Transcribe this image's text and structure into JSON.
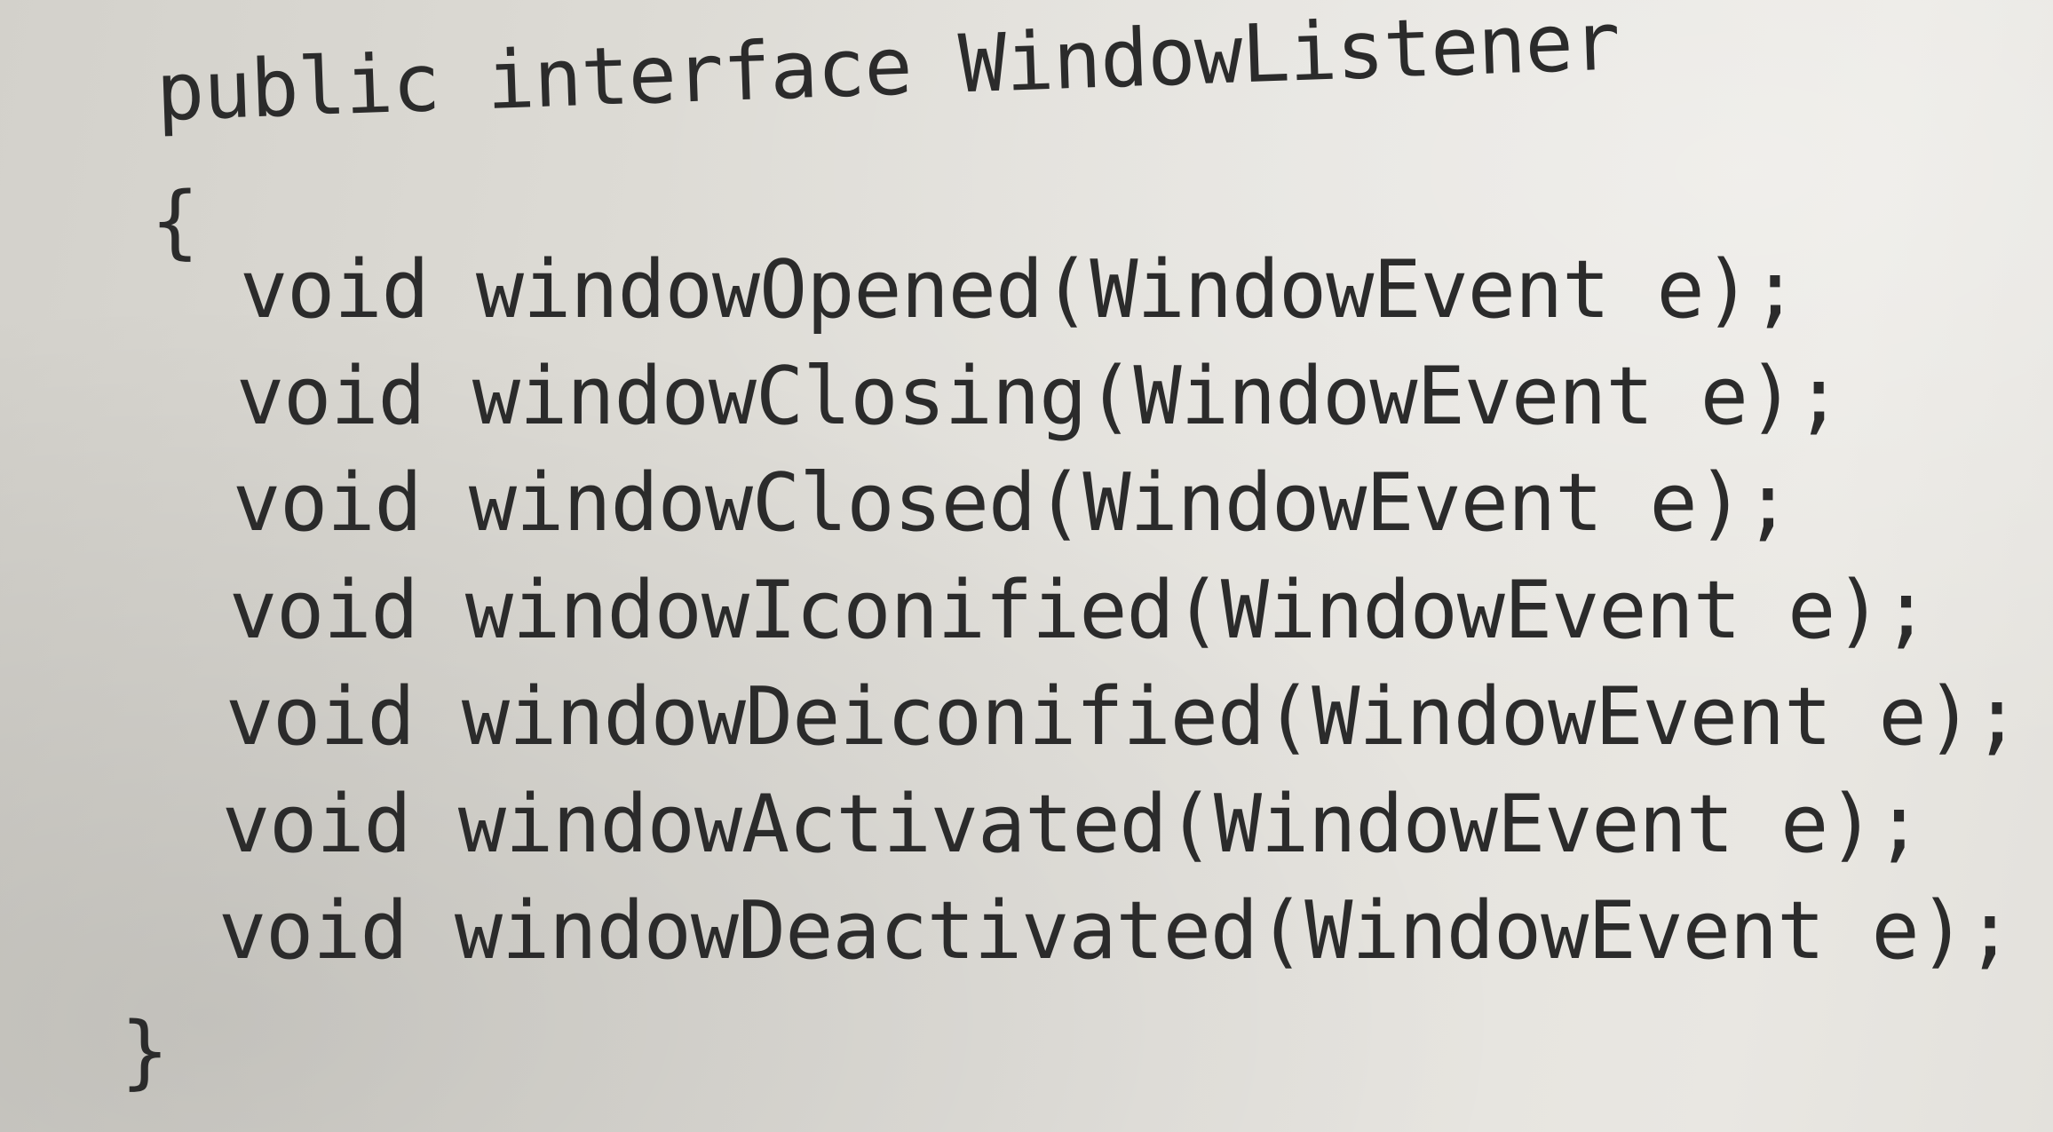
{
  "code": {
    "lines": [
      "public interface WindowListener",
      "{",
      "void windowOpened(WindowEvent e);",
      "void windowClosing(WindowEvent e);",
      "void windowClosed(WindowEvent e);",
      "void windowIconified(WindowEvent e);",
      "void windowDeiconified(WindowEvent e);",
      "void windowActivated(WindowEvent e);",
      "void windowDeactivated(WindowEvent e);",
      "}"
    ]
  }
}
